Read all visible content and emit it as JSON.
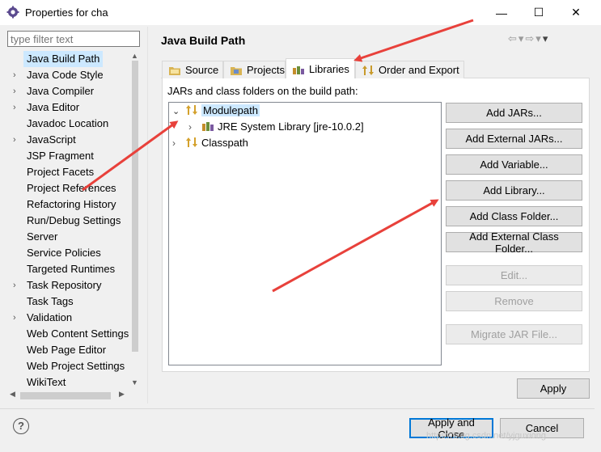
{
  "window": {
    "title": "Properties for cha",
    "minimize_glyph": "—",
    "maximize_glyph": "☐",
    "close_glyph": "✕"
  },
  "filter": {
    "placeholder": "type filter text"
  },
  "nav": {
    "items": [
      {
        "label": "Java Build Path",
        "expandable": false,
        "selected": true
      },
      {
        "label": "Java Code Style",
        "expandable": true
      },
      {
        "label": "Java Compiler",
        "expandable": true
      },
      {
        "label": "Java Editor",
        "expandable": true
      },
      {
        "label": "Javadoc Location",
        "expandable": false
      },
      {
        "label": "JavaScript",
        "expandable": true
      },
      {
        "label": "JSP Fragment",
        "expandable": false
      },
      {
        "label": "Project Facets",
        "expandable": false
      },
      {
        "label": "Project References",
        "expandable": false
      },
      {
        "label": "Refactoring History",
        "expandable": false
      },
      {
        "label": "Run/Debug Settings",
        "expandable": false
      },
      {
        "label": "Server",
        "expandable": false
      },
      {
        "label": "Service Policies",
        "expandable": false
      },
      {
        "label": "Targeted Runtimes",
        "expandable": false
      },
      {
        "label": "Task Repository",
        "expandable": true
      },
      {
        "label": "Task Tags",
        "expandable": false
      },
      {
        "label": "Validation",
        "expandable": true
      },
      {
        "label": "Web Content Settings",
        "expandable": false
      },
      {
        "label": "Web Page Editor",
        "expandable": false
      },
      {
        "label": "Web Project Settings",
        "expandable": false
      },
      {
        "label": "WikiText",
        "expandable": false
      }
    ]
  },
  "page": {
    "title": "Java Build Path",
    "tabs": [
      {
        "label": "Source"
      },
      {
        "label": "Projects"
      },
      {
        "label": "Libraries",
        "active": true
      },
      {
        "label": "Order and Export"
      }
    ],
    "build_path_label": "JARs and class folders on the build path:",
    "tree": {
      "modulepath": "Modulepath",
      "jre": "JRE System Library [jre-10.0.2]",
      "classpath": "Classpath"
    },
    "buttons": {
      "add_jars": "Add JARs...",
      "add_external_jars": "Add External JARs...",
      "add_variable": "Add Variable...",
      "add_library": "Add Library...",
      "add_class_folder": "Add Class Folder...",
      "add_external_class_folder": "Add External Class Folder...",
      "edit": "Edit...",
      "remove": "Remove",
      "migrate_jar": "Migrate JAR File...",
      "apply": "Apply"
    }
  },
  "footer": {
    "apply_and_close": "Apply and Close",
    "cancel": "Cancel",
    "help_glyph": "?",
    "watermark": "https://blog.csdn.net/yjguxiong"
  },
  "colors": {
    "annotation_arrow": "#e8413b",
    "selection": "#cce8ff",
    "focus_border": "#0078d7"
  }
}
